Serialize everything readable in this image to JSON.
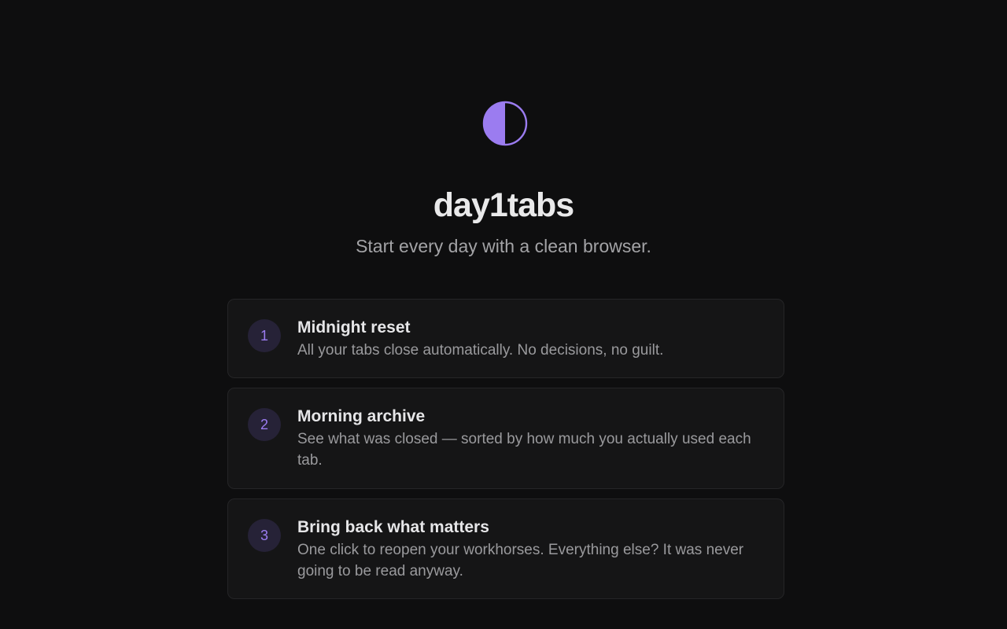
{
  "app": {
    "logo_icon": "half-moon-icon",
    "title": "day1tabs",
    "subtitle": "Start every day with a clean browser."
  },
  "colors": {
    "background": "#0e0e0f",
    "accent": "#9b7cf0",
    "card": "#151516"
  },
  "steps": [
    {
      "number": "1",
      "title": "Midnight reset",
      "description": "All your tabs close automatically. No decisions, no guilt."
    },
    {
      "number": "2",
      "title": "Morning archive",
      "description": "See what was closed — sorted by how much you actually used each tab."
    },
    {
      "number": "3",
      "title": "Bring back what matters",
      "description": "One click to reopen your workhorses. Everything else? It was never going to be read anyway."
    }
  ]
}
